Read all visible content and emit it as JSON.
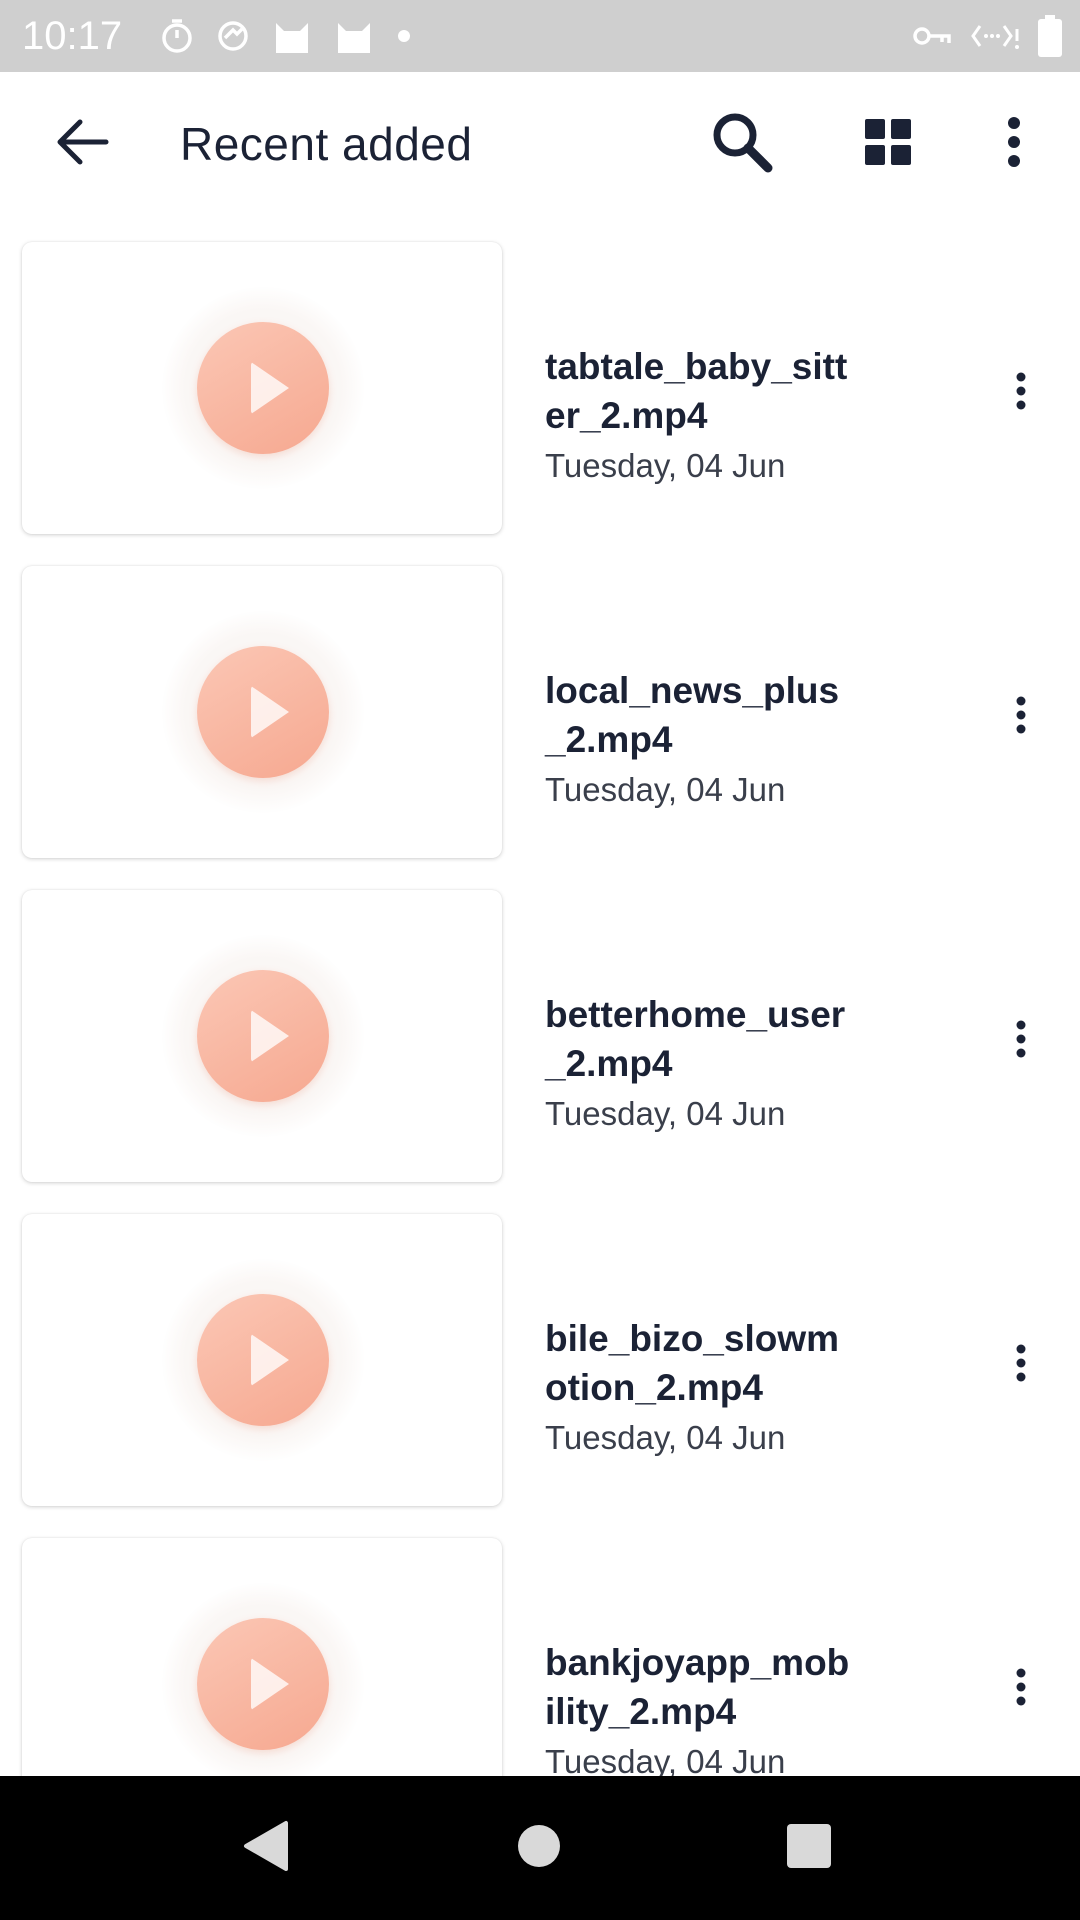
{
  "status_bar": {
    "time": "10:17",
    "left_icons": [
      "timer-icon",
      "sync-icon",
      "cat-icon",
      "cat-icon",
      "dot-icon"
    ],
    "right_icons": [
      "vpn-key-icon",
      "data-saver-icon",
      "battery-icon"
    ]
  },
  "app_bar": {
    "title": "Recent added",
    "back_icon": "arrow-back-icon",
    "actions": [
      "search-icon",
      "grid-view-icon",
      "more-vert-icon"
    ]
  },
  "colors": {
    "title_text": "#1b2235",
    "play_button": "#f8b4a0",
    "status_bar_bg": "#cfcfcf",
    "nav_bar_bg": "#000000"
  },
  "videos": [
    {
      "name": "tabtale_baby_sitter_2.mp4",
      "date": "Tuesday, 04 Jun"
    },
    {
      "name": "local_news_plus_2.mp4",
      "date": "Tuesday, 04 Jun"
    },
    {
      "name": "betterhome_user_2.mp4",
      "date": "Tuesday, 04 Jun"
    },
    {
      "name": "bile_bizo_slowmotion_2.mp4",
      "date": "Tuesday, 04 Jun"
    },
    {
      "name": "bankjoyapp_mobility_2.mp4",
      "date": "Tuesday, 04 Jun"
    }
  ],
  "nav_bar": {
    "buttons": [
      "nav-back-icon",
      "nav-home-icon",
      "nav-recents-icon"
    ]
  }
}
